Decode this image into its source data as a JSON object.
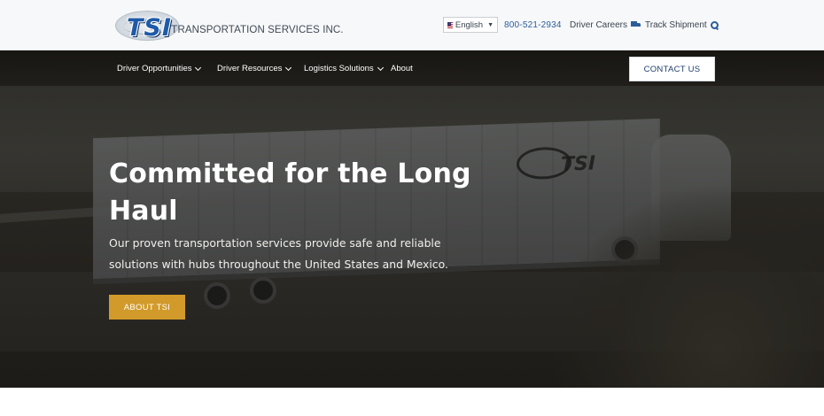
{
  "header": {
    "logo_mark": "TSI",
    "logo_text": "TRANSPORTATION SERVICES INC.",
    "language": {
      "selected": "English"
    },
    "phone": "800-521-2934",
    "driver_careers": "Driver Careers",
    "track_shipment": "Track Shipment"
  },
  "nav": {
    "items": [
      {
        "label": "Driver Opportunities",
        "has_dropdown": true
      },
      {
        "label": "Driver Resources",
        "has_dropdown": true
      },
      {
        "label": "Logistics Solutions",
        "has_dropdown": true
      },
      {
        "label": "About",
        "has_dropdown": false
      }
    ],
    "contact_label": "CONTACT US"
  },
  "hero": {
    "headline": "Committed for the Long Haul",
    "subtext": "Our proven transportation services provide safe and reliable solutions with hubs throughout the United States and Mexico.",
    "cta_label": "ABOUT TSI",
    "trailer_logo": "TSI"
  },
  "colors": {
    "brand_blue": "#2b5d9b",
    "cta_gold": "#d19a2a",
    "nav_text": "#ffffff"
  },
  "icons": {
    "language_flag": "us-flag-icon",
    "language_caret": "chevron-down-icon",
    "careers": "truck-icon",
    "track": "search-icon"
  }
}
